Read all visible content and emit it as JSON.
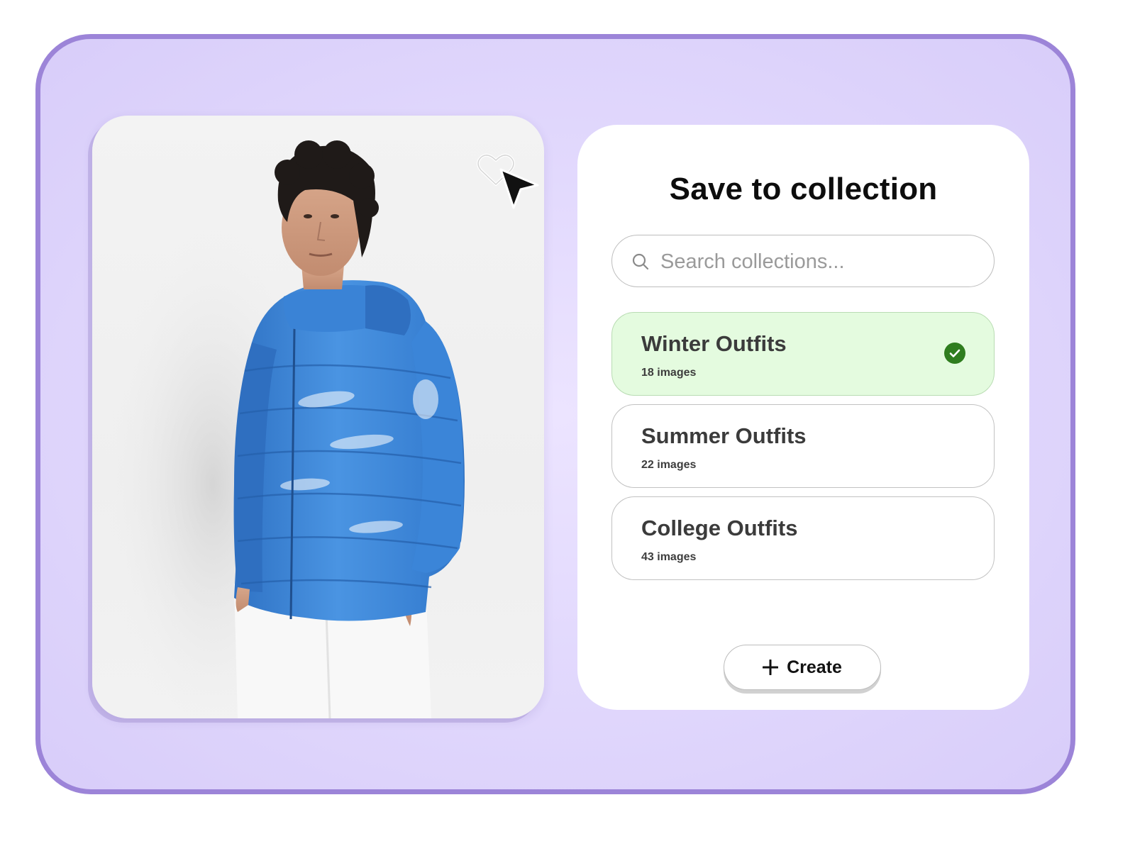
{
  "dialog": {
    "title": "Save to collection",
    "search": {
      "placeholder": "Search collections...",
      "value": ""
    },
    "collections": [
      {
        "name": "Winter Outfits",
        "count": "18 images",
        "selected": true
      },
      {
        "name": "Summer Outfits",
        "count": "22 images",
        "selected": false
      },
      {
        "name": "College Outfits",
        "count": "43 images",
        "selected": false
      }
    ],
    "create_label": "Create"
  },
  "photo": {
    "subject": "man in blue puffer jacket",
    "favorite_icon": "heart-outline-icon",
    "cursor_icon": "mouse-pointer-icon"
  },
  "colors": {
    "frame_border": "#9c84d8",
    "background": "#e2d9fd",
    "selected_fill": "#e4fbdf",
    "check_green": "#2f7d1f",
    "jacket_blue": "#3f86d6"
  }
}
